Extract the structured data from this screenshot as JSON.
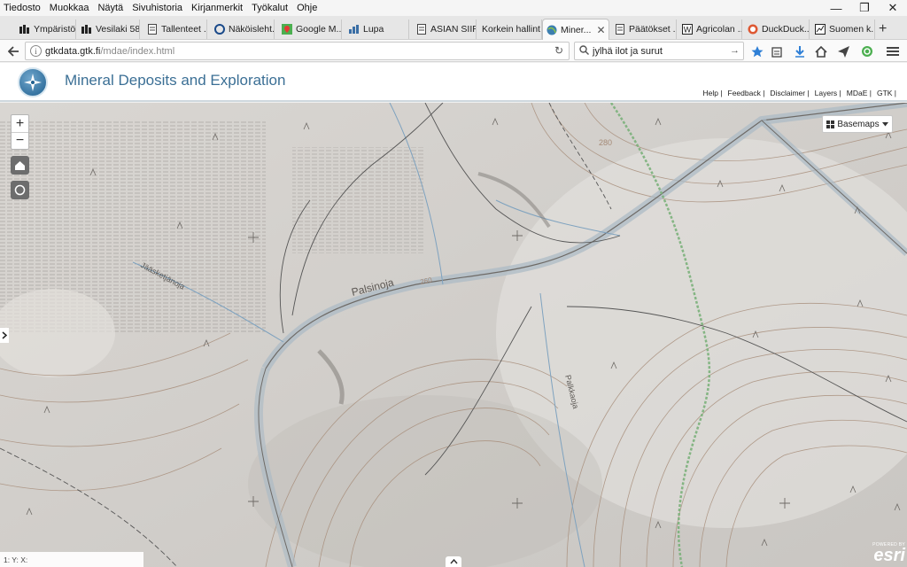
{
  "browser": {
    "menu": [
      "Tiedosto",
      "Muokkaa",
      "Näytä",
      "Sivuhistoria",
      "Kirjanmerkit",
      "Työkalut",
      "Ohje"
    ],
    "window_controls": [
      "—",
      "❐",
      "✕"
    ],
    "tabs": [
      {
        "label": "Ympäristö...",
        "icon": "bars-icon"
      },
      {
        "label": "Vesilaki 58...",
        "icon": "bars-icon"
      },
      {
        "label": "Tallenteet ...",
        "icon": "document-icon"
      },
      {
        "label": "Näköisleht...",
        "icon": "circle-icon"
      },
      {
        "label": "Google M...",
        "icon": "map-pin-icon"
      },
      {
        "label": "Lupa",
        "icon": "chart-icon"
      },
      {
        "label": "ASIAN SIIR...",
        "icon": "document-icon"
      },
      {
        "label": "Korkein hallint...",
        "icon": ""
      },
      {
        "label": "Miner...",
        "icon": "globe-icon"
      },
      {
        "label": "Päätökset ...",
        "icon": "document-icon"
      },
      {
        "label": "Agricolan ...",
        "icon": "w-icon"
      },
      {
        "label": "DuckDuck...",
        "icon": "duck-icon"
      },
      {
        "label": "Suomen k...",
        "icon": "chart-icon"
      }
    ],
    "close_tab": "✕",
    "new_tab": "+",
    "url_host": "gtkdata.gtk.fi",
    "url_prefix": "",
    "url_path": "/mdae/index.html",
    "search_query": "jylhä ilot ja surut"
  },
  "app": {
    "title": "Mineral Deposits and Exploration",
    "links": [
      "Help |",
      "Feedback |",
      "Disclaimer |",
      "Layers |",
      "MDaE |",
      "GTK |"
    ]
  },
  "map": {
    "zoom_in": "+",
    "zoom_out": "−",
    "basemaps_label": "Basemaps",
    "coords_text": "1:  Y:  X:",
    "labels": {
      "river_main": "Palsinoja",
      "river_nw": "Jääsketjänoja",
      "river_s": "Palkkaoja",
      "contour_a": "280",
      "contour_b": "260"
    },
    "attribution_top": "POWERED BY",
    "attribution_logo": "esri"
  }
}
